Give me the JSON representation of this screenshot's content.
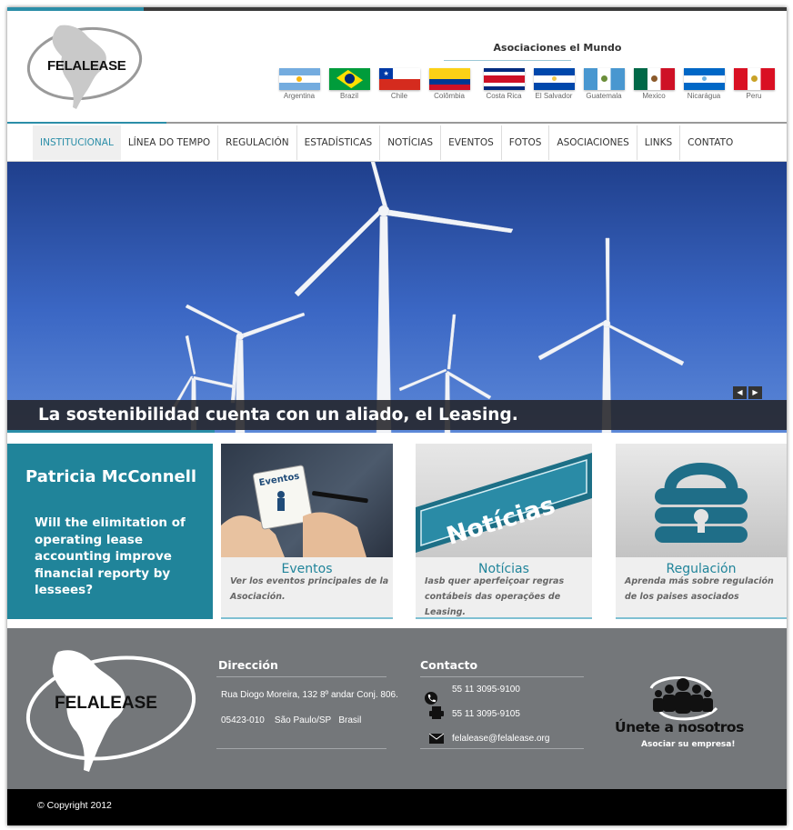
{
  "brand": {
    "logo_text": "FELALEASE"
  },
  "associations": {
    "title": "Asociaciones el Mundo",
    "countries": [
      {
        "name": "Argentina"
      },
      {
        "name": "Brazil"
      },
      {
        "name": "Chile"
      },
      {
        "name": "Colômbia"
      },
      {
        "name": "Costa Rica"
      },
      {
        "name": "El Salvador"
      },
      {
        "name": "Guatemala"
      },
      {
        "name": "Mexico"
      },
      {
        "name": "Nicarágua"
      },
      {
        "name": "Peru"
      }
    ]
  },
  "nav": {
    "items": [
      "INSTITUCIONAL",
      "LÍNEA DO TEMPO",
      "REGULACIÓN",
      "ESTADÍSTICAS",
      "NOTÍCIAS",
      "EVENTOS",
      "FOTOS",
      "ASOCIACIONES",
      "LINKS",
      "CONTATO"
    ],
    "active": "INSTITUCIONAL"
  },
  "hero": {
    "caption": "La sostenibilidad cuenta con un aliado, el Leasing.",
    "prev": "◀",
    "next": "▶"
  },
  "quote": {
    "name": "Patricia McConnell",
    "text": "Will the elimitation of operating lease accounting improve financial reporty by lessees?"
  },
  "cards": [
    {
      "image_label": "Eventos",
      "title": "Eventos",
      "desc": "Ver los eventos principales de la Asociación."
    },
    {
      "image_label": "Notícias",
      "title": "Notícias",
      "desc": "Iasb quer aperfeiçoar regras contábeis das operações de Leasing."
    },
    {
      "image_label": "",
      "title": "Regulación",
      "desc": "Aprenda más sobre regulación de los paises asociados"
    }
  ],
  "footer": {
    "logo_text": "FELALEASE",
    "address": {
      "title": "Dirección",
      "line1": "Rua Diogo Moreira, 132 8º andar Conj. 806.",
      "line2": "05423-010    São Paulo/SP   Brasil"
    },
    "contact": {
      "title": "Contacto",
      "phone": "55 11 3095-9100",
      "fax": "55 11 3095-9105",
      "email": "felalease@felalease.org"
    },
    "join": {
      "title": "Únete a nosotros",
      "subtitle": "Asociar su empresa!"
    }
  },
  "copyright": "© Copyright 2012",
  "colors": {
    "accent": "#20849a",
    "footer": "#74777a",
    "hero_sky": "#3b67c4"
  }
}
